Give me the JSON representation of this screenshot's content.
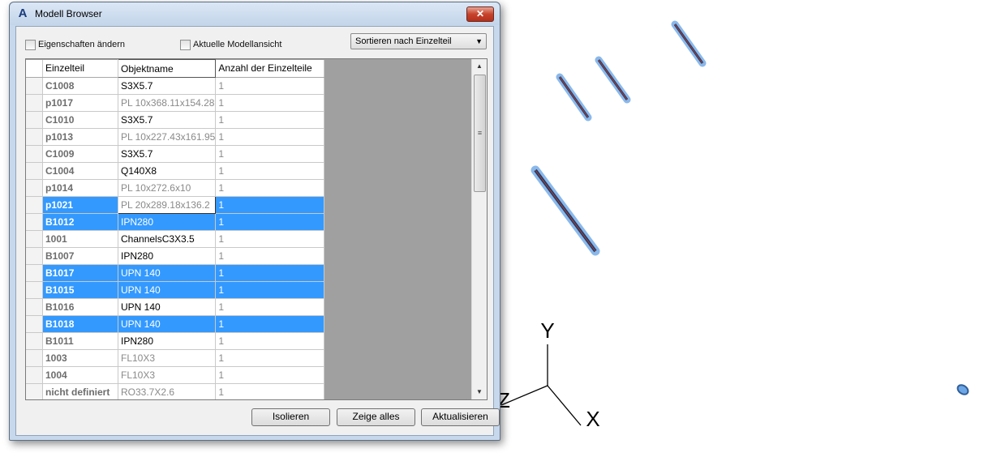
{
  "dialog": {
    "title": "Modell Browser",
    "close_label": "✕",
    "checkbox_properties": "Eigenschaften ändern",
    "checkbox_current_view": "Aktuelle Modellansicht",
    "sort_select": {
      "value": "Sortieren nach Einzelteil"
    }
  },
  "table": {
    "columns": [
      "Einzelteil",
      "Objektname",
      "Anzahl der Einzelteile"
    ],
    "rows": [
      {
        "part": "C1008",
        "name": "S3X5.7",
        "count": "1",
        "selected": false,
        "name_style": "black"
      },
      {
        "part": "p1017",
        "name": "PL 10x368.11x154.28",
        "count": "1",
        "selected": false,
        "name_style": "gray"
      },
      {
        "part": "C1010",
        "name": "S3X5.7",
        "count": "1",
        "selected": false,
        "name_style": "black"
      },
      {
        "part": "p1013",
        "name": "PL 10x227.43x161.95",
        "count": "1",
        "selected": false,
        "name_style": "gray"
      },
      {
        "part": "C1009",
        "name": "S3X5.7",
        "count": "1",
        "selected": false,
        "name_style": "black"
      },
      {
        "part": "C1004",
        "name": "Q140X8",
        "count": "1",
        "selected": false,
        "name_style": "black"
      },
      {
        "part": "p1014",
        "name": "PL 10x272.6x10",
        "count": "1",
        "selected": false,
        "name_style": "gray"
      },
      {
        "part": "p1021",
        "name": "PL 20x289.18x136.2",
        "count": "1",
        "selected": true,
        "editing": true,
        "name_style": "gray"
      },
      {
        "part": "B1012",
        "name": "IPN280",
        "count": "1",
        "selected": true,
        "name_style": "black"
      },
      {
        "part": "1001",
        "name": "ChannelsC3X3.5",
        "count": "1",
        "selected": false,
        "name_style": "black"
      },
      {
        "part": "B1007",
        "name": "IPN280",
        "count": "1",
        "selected": false,
        "name_style": "black"
      },
      {
        "part": "B1017",
        "name": "UPN 140",
        "count": "1",
        "selected": true,
        "name_style": "black"
      },
      {
        "part": "B1015",
        "name": "UPN 140",
        "count": "1",
        "selected": true,
        "name_style": "black"
      },
      {
        "part": "B1016",
        "name": "UPN 140",
        "count": "1",
        "selected": false,
        "name_style": "black"
      },
      {
        "part": "B1018",
        "name": "UPN 140",
        "count": "1",
        "selected": true,
        "name_style": "black"
      },
      {
        "part": "B1011",
        "name": "IPN280",
        "count": "1",
        "selected": false,
        "name_style": "black"
      },
      {
        "part": "1003",
        "name": "FL10X3",
        "count": "1",
        "selected": false,
        "name_style": "gray"
      },
      {
        "part": "1004",
        "name": "FL10X3",
        "count": "1",
        "selected": false,
        "name_style": "gray"
      },
      {
        "part": "nicht definiert",
        "name": "RO33.7X2.6",
        "count": "1",
        "selected": false,
        "name_style": "gray"
      }
    ]
  },
  "buttons": {
    "isolate": "Isolieren",
    "show_all": "Zeige alles",
    "refresh": "Aktualisieren"
  },
  "ucs": {
    "x_label": "X",
    "y_label": "Y",
    "z_label": "Z"
  },
  "colors": {
    "selection": "#3399ff",
    "model_part": "#2f7fc8"
  }
}
